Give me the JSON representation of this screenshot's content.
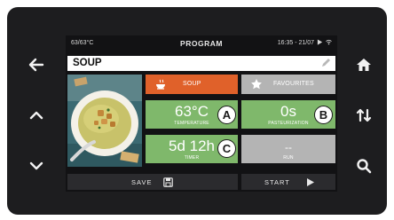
{
  "status": {
    "left": "63/63°C",
    "title": "PROGRAM",
    "time": "16:35 - 21/07"
  },
  "program": {
    "name": "SOUP",
    "edit_icon": "pencil-icon"
  },
  "tiles": {
    "category": {
      "label": "SOUP",
      "icon": "soup-bowl-icon",
      "color": "#e0612a"
    },
    "favourites": {
      "label": "FAVOURITES",
      "icon": "star-icon"
    },
    "temperature": {
      "value": "63°C",
      "label": "TEMPERATURE",
      "marker": "A",
      "color": "#7fb86b"
    },
    "pasteurization": {
      "value": "0s",
      "label": "PASTEURIZATION",
      "marker": "B"
    },
    "timer": {
      "value": "5d 12h",
      "label": "TIMER",
      "marker": "C"
    },
    "aux": {
      "value": "--",
      "label": "RUN"
    }
  },
  "actions": {
    "save_label": "SAVE",
    "start_label": "START"
  },
  "side_keys": {
    "left": [
      "back-arrow-icon",
      "chevron-up-icon",
      "chevron-down-icon"
    ],
    "right": [
      "home-icon",
      "sort-arrows-icon",
      "search-icon"
    ]
  }
}
